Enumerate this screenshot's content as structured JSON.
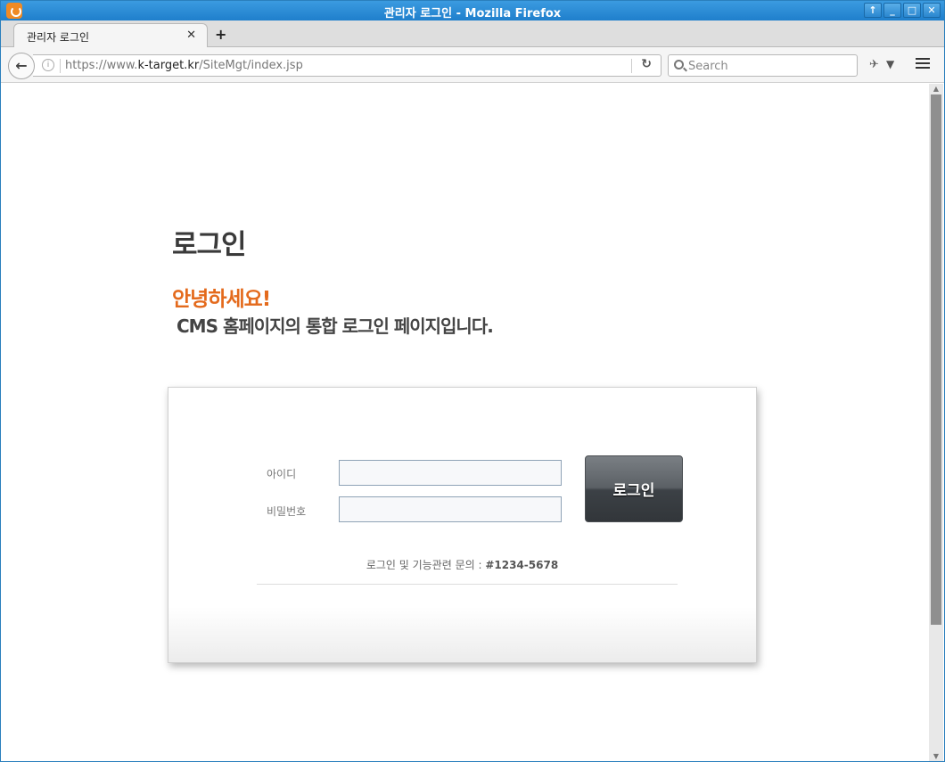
{
  "window": {
    "title": "관리자 로그인 - Mozilla Firefox",
    "buttons": [
      "↑",
      "_",
      "□",
      "✕"
    ]
  },
  "tabs": [
    {
      "label": "관리자 로그인",
      "close": "✕"
    }
  ],
  "newtab": "+",
  "navbar": {
    "url_prefix": "https://www.",
    "url_host": "k-target.kr",
    "url_path": "/SiteMgt/index.jsp",
    "search_placeholder": "Search"
  },
  "page": {
    "title": "로그인",
    "greeting": "안녕하세요!",
    "subtitle": "CMS 홈페이지의 통합 로그인 페이지입니다.",
    "id_label": "아이디",
    "pw_label": "비밀번호",
    "login_button": "로그인",
    "contact_text": "로그인 및 기능관련 문의 : ",
    "contact_phone": "#1234-5678"
  },
  "icons": {
    "app": "firefox-icon",
    "back": "back-arrow-icon",
    "info": "info-icon",
    "reload": "reload-icon",
    "search": "search-icon",
    "addon": "addon-icon",
    "menu": "hamburger-menu-icon"
  }
}
